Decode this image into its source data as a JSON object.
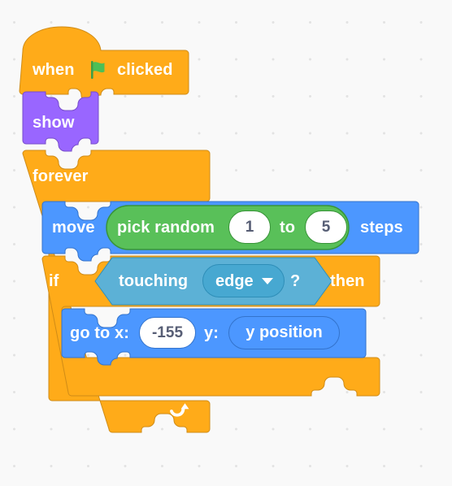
{
  "workspace": {
    "name": "scratch-blocks-workspace",
    "background_color": "#F9F9F9",
    "dot_grid_color": "#E3E3E3"
  },
  "palette": {
    "events_orange": "#FFAB19",
    "control_orange": "#FFAB19",
    "control_orange_stroke": "#CF8B17",
    "looks_purple": "#9966FF",
    "looks_purple_stroke": "#774DCB",
    "motion_blue": "#4C97FF",
    "motion_blue_stroke": "#3373CC",
    "operators_green": "#59C059",
    "operators_green_stroke": "#389438",
    "sensing_teal": "#5CB1D6",
    "sensing_teal_stroke": "#2E8EB8",
    "input_white": "#FFFFFF",
    "input_text": "#575E75",
    "block_text": "#FFFFFF",
    "flag_green": "#4CBF56"
  },
  "script": {
    "name": "sprite-script-stack",
    "blocks": [
      {
        "id": "when-flag-clicked",
        "type": "hat",
        "category": "events",
        "label_before": "when",
        "icon": "green-flag-icon",
        "label_after": "clicked"
      },
      {
        "id": "show",
        "type": "stack",
        "category": "looks",
        "label": "show"
      },
      {
        "id": "forever",
        "type": "c-loop",
        "category": "control",
        "label": "forever",
        "loop_icon": "loop-arrow-icon"
      },
      {
        "id": "move-steps",
        "type": "stack",
        "category": "motion",
        "label_before": "move",
        "label_after": "steps",
        "input": {
          "id": "pick-random",
          "type": "reporter",
          "category": "operators",
          "label_before": "pick random",
          "label_middle": "to",
          "value_from": "1",
          "value_to": "5"
        }
      },
      {
        "id": "if-then",
        "type": "c-conditional",
        "category": "control",
        "label_if": "if",
        "label_then": "then",
        "condition": {
          "id": "touching",
          "type": "boolean",
          "category": "sensing",
          "label_before": "touching",
          "label_after": "?",
          "dropdown_value": "edge",
          "dropdown_icon": "chevron-down-icon"
        }
      },
      {
        "id": "go-to-xy",
        "type": "stack",
        "category": "motion",
        "label_x": "go to x:",
        "label_y": "y:",
        "value_x": "-155",
        "input_y": {
          "id": "y-position",
          "type": "reporter",
          "category": "motion",
          "label": "y position"
        }
      }
    ]
  }
}
